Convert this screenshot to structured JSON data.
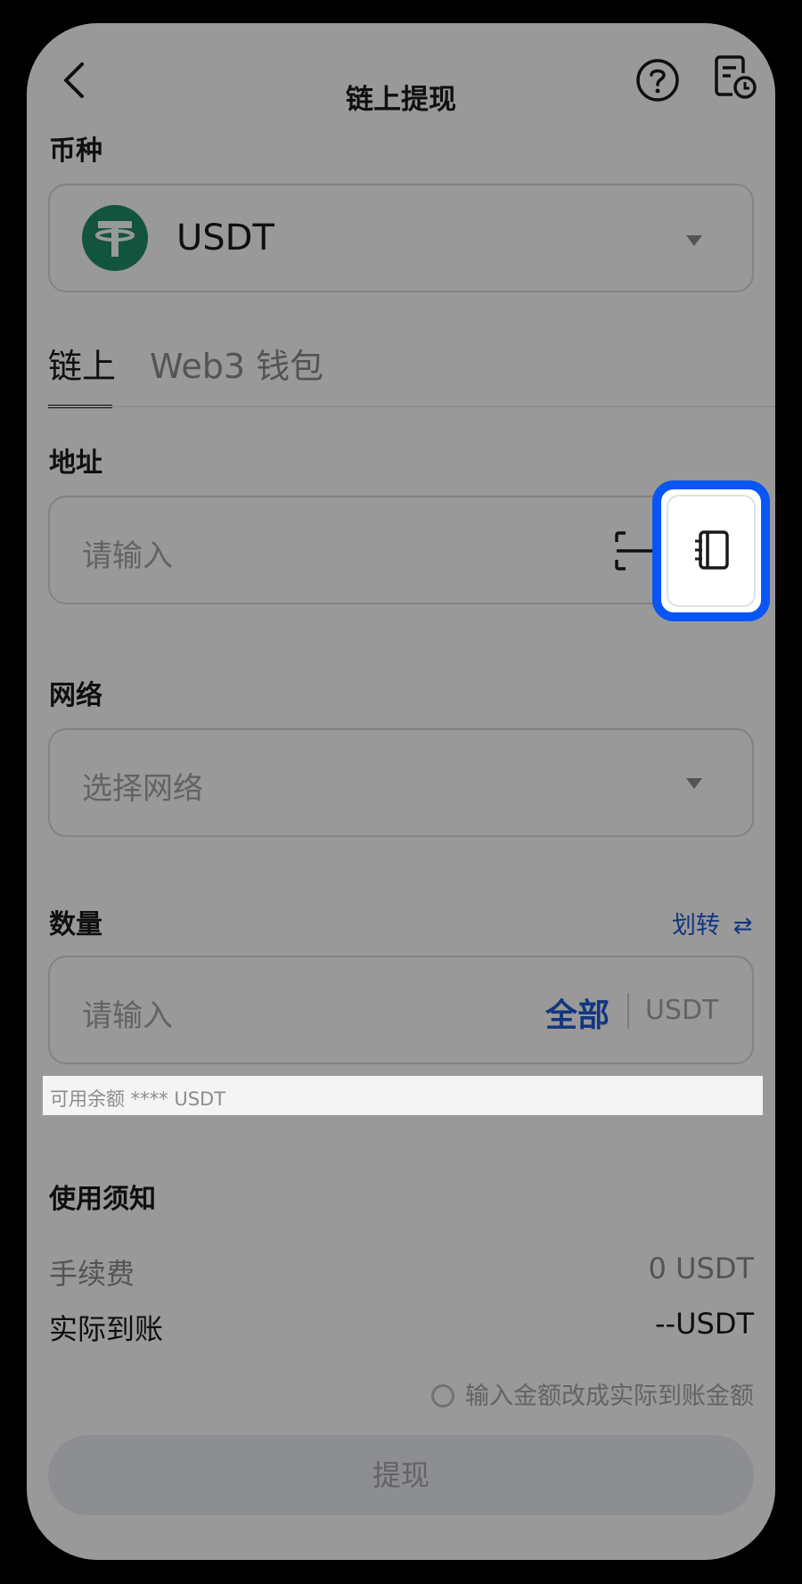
{
  "header": {
    "title": "链上提现",
    "back_icon": "back-arrow-icon",
    "help_icon": "help-icon",
    "records_icon": "records-icon"
  },
  "coin": {
    "label": "币种",
    "value": "USDT",
    "icon": "tether-icon"
  },
  "tabs": [
    {
      "label": "链上",
      "active": true
    },
    {
      "label": "Web3 钱包",
      "active": false
    }
  ],
  "address": {
    "label": "地址",
    "placeholder": "请输入",
    "scan_icon": "scan-icon",
    "book_icon": "address-book-icon"
  },
  "network": {
    "label": "网络",
    "placeholder": "选择网络"
  },
  "amount": {
    "label": "数量",
    "transfer_label": "划转",
    "placeholder": "请输入",
    "all_label": "全部",
    "unit": "USDT",
    "available": "可用余额 **** USDT"
  },
  "notice": {
    "title": "使用须知",
    "fee_label": "手续费",
    "fee_value": "0 USDT",
    "received_label": "实际到账",
    "received_value": "--USDT",
    "convert_hint": "输入金额改成实际到账金额"
  },
  "submit": {
    "label": "提现"
  },
  "colors": {
    "accent": "#0a55f5",
    "tether": "#1f8c68",
    "link_blue": "#1f5bd6"
  }
}
